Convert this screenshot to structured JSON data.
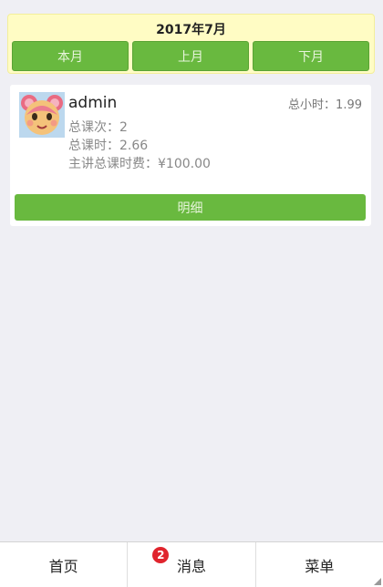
{
  "header": {
    "month_title": "2017年7月",
    "buttons": {
      "this_month": "本月",
      "prev_month": "上月",
      "next_month": "下月"
    }
  },
  "card": {
    "user_name": "admin",
    "total_hours_label": "总小时：",
    "total_hours_value": "1.99",
    "stats": [
      {
        "label": "总课次：",
        "value": "2"
      },
      {
        "label": "总课时：",
        "value": "2.66"
      },
      {
        "label": "主讲总课时费：",
        "value": "¥100.00"
      }
    ],
    "detail_button": "明细"
  },
  "tabbar": {
    "tabs": [
      {
        "label": "首页"
      },
      {
        "label": "消息",
        "badge": "2"
      },
      {
        "label": "菜单"
      }
    ]
  },
  "colors": {
    "accent_green": "#69b93f",
    "header_bg": "#fffcc4",
    "badge_red": "#e0242d",
    "page_bg": "#efeff4"
  },
  "icons": {
    "avatar": "cartoon-bear-avatar"
  }
}
